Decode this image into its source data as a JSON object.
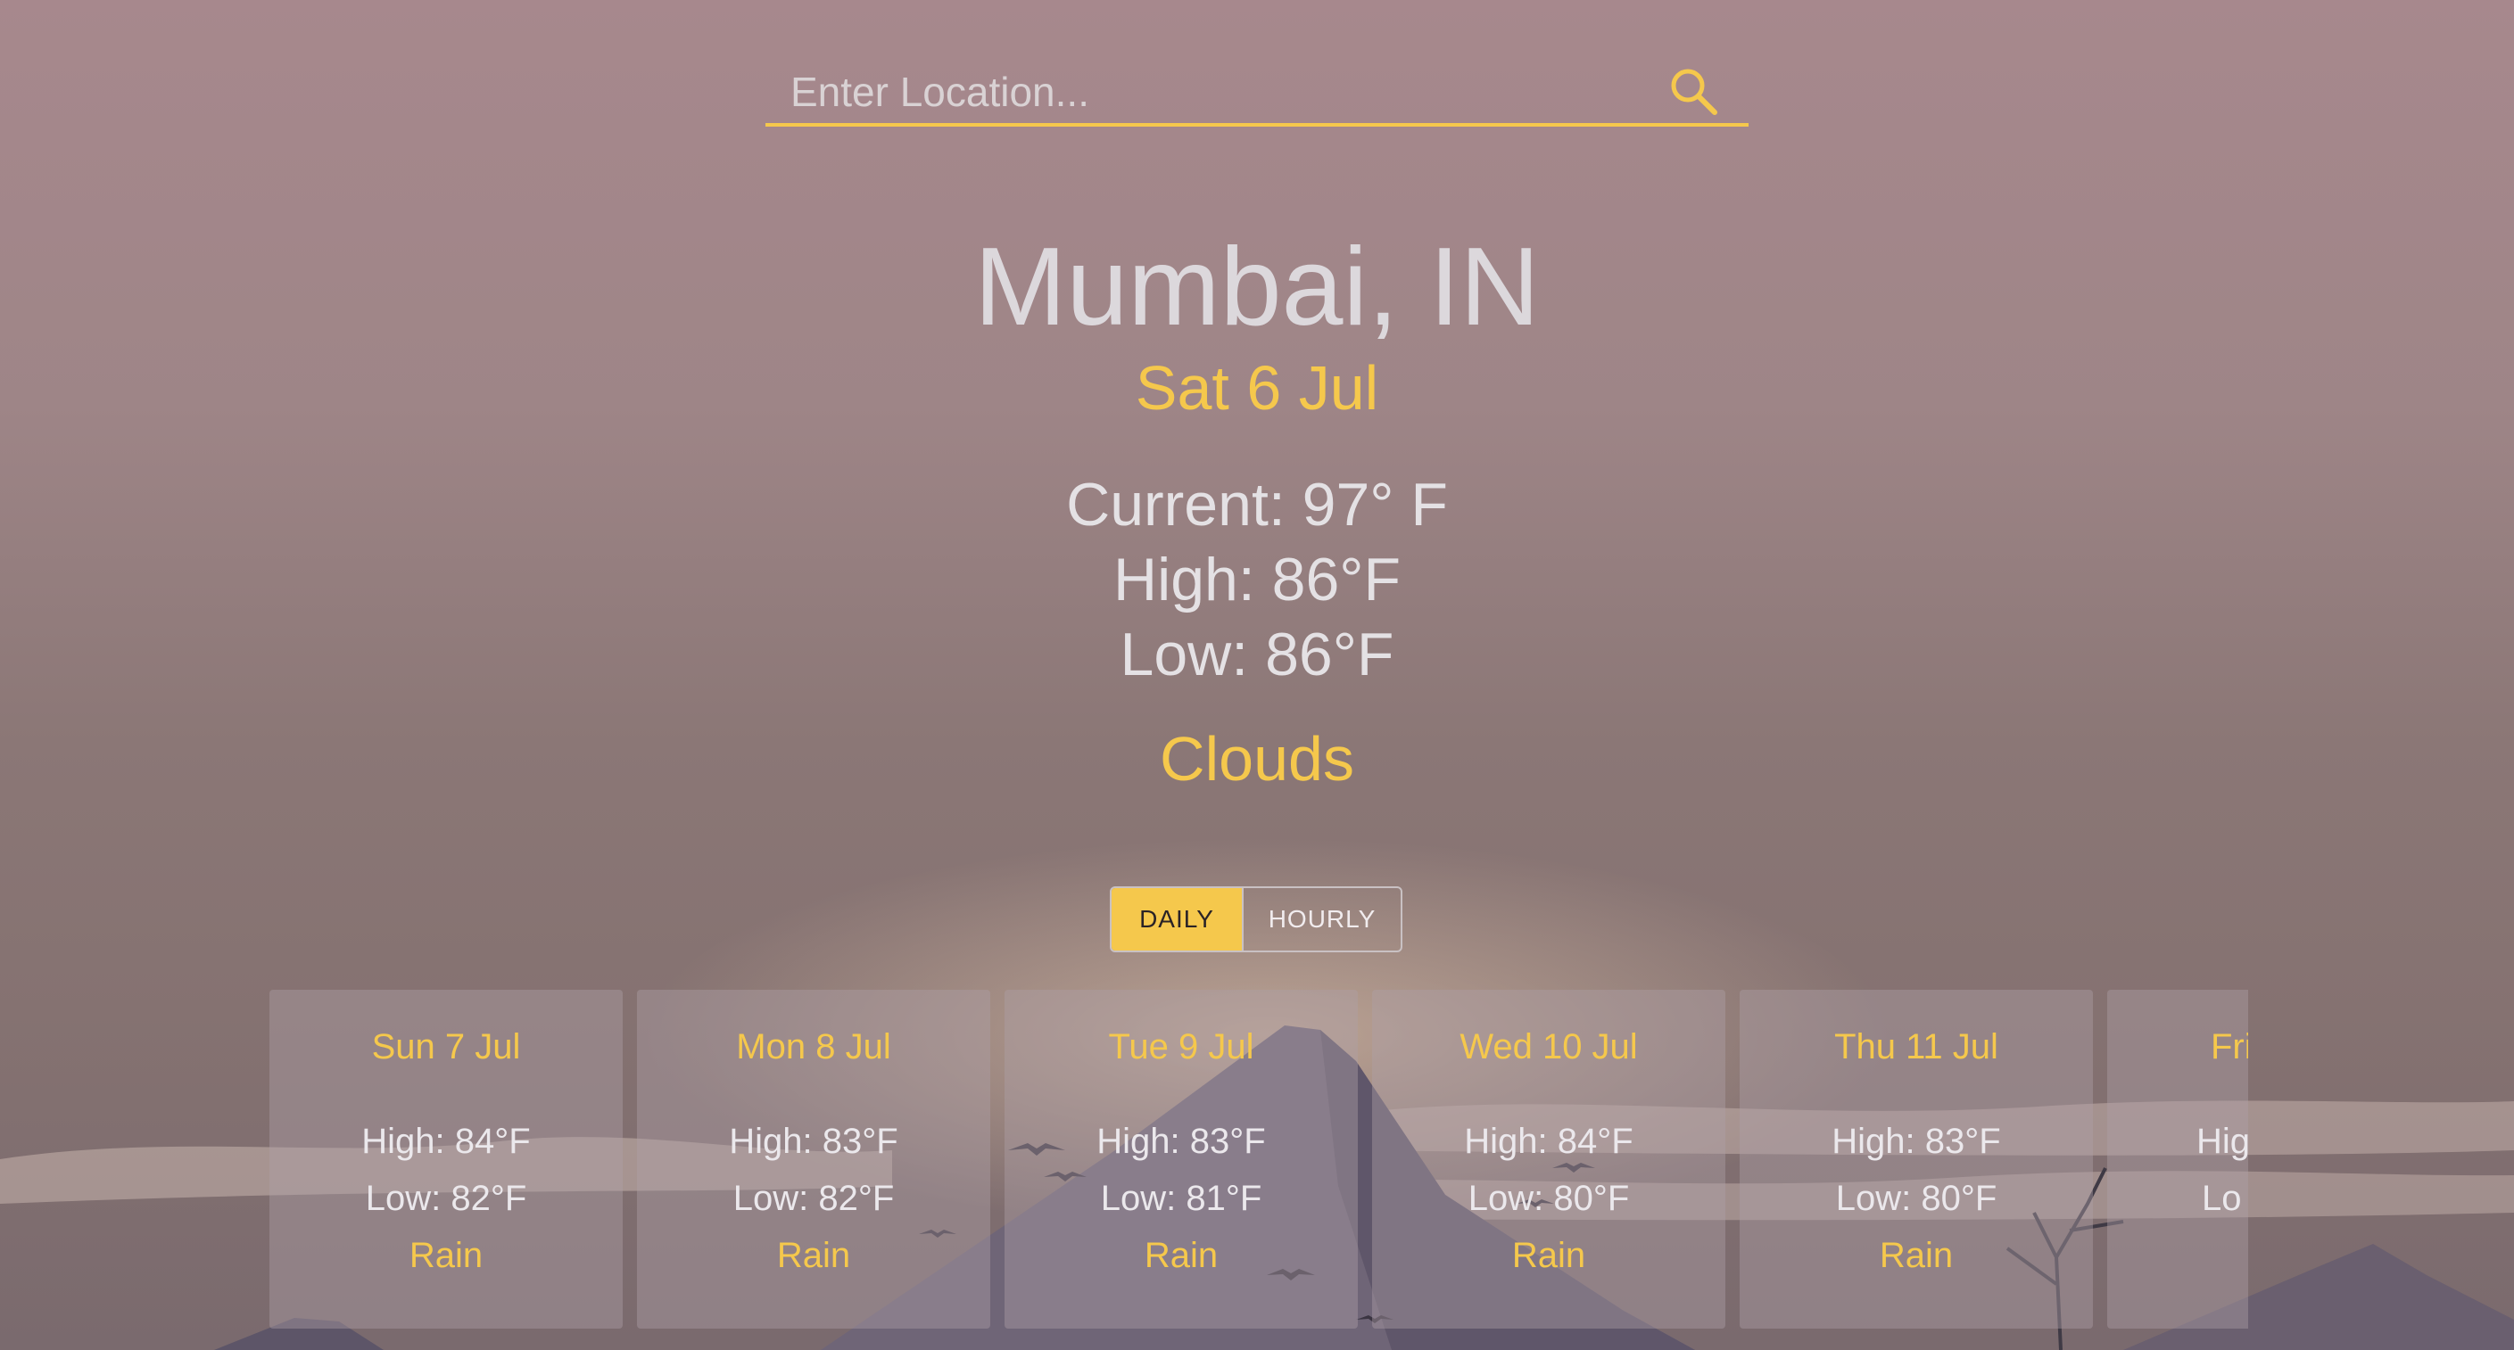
{
  "search": {
    "placeholder": "Enter Location...",
    "value": ""
  },
  "location": {
    "city": "Mumbai, IN",
    "date": "Sat 6 Jul"
  },
  "current": {
    "current_text": "Current: 97° F",
    "high_text": "High: 86°F",
    "low_text": "Low: 86°F",
    "condition": "Clouds"
  },
  "toggle": {
    "daily_label": "DAILY",
    "hourly_label": "HOURLY",
    "selected": "DAILY"
  },
  "forecast": [
    {
      "day": "Sun 7 Jul",
      "high": "High: 84°F",
      "low": "Low: 82°F",
      "condition": "Rain"
    },
    {
      "day": "Mon 8 Jul",
      "high": "High: 83°F",
      "low": "Low: 82°F",
      "condition": "Rain"
    },
    {
      "day": "Tue 9 Jul",
      "high": "High: 83°F",
      "low": "Low: 81°F",
      "condition": "Rain"
    },
    {
      "day": "Wed 10 Jul",
      "high": "High: 84°F",
      "low": "Low: 80°F",
      "condition": "Rain"
    },
    {
      "day": "Thu 11 Jul",
      "high": "High: 83°F",
      "low": "Low: 80°F",
      "condition": "Rain"
    },
    {
      "day": "Fri",
      "high": "Hig",
      "low": "Lo",
      "condition": ""
    }
  ],
  "colors": {
    "accent": "#f5c84c",
    "text_light": "#e4e1e4",
    "background_top": "#a7888d",
    "background_bottom": "#7a6a6e"
  },
  "icons": {
    "search": "search-icon"
  }
}
